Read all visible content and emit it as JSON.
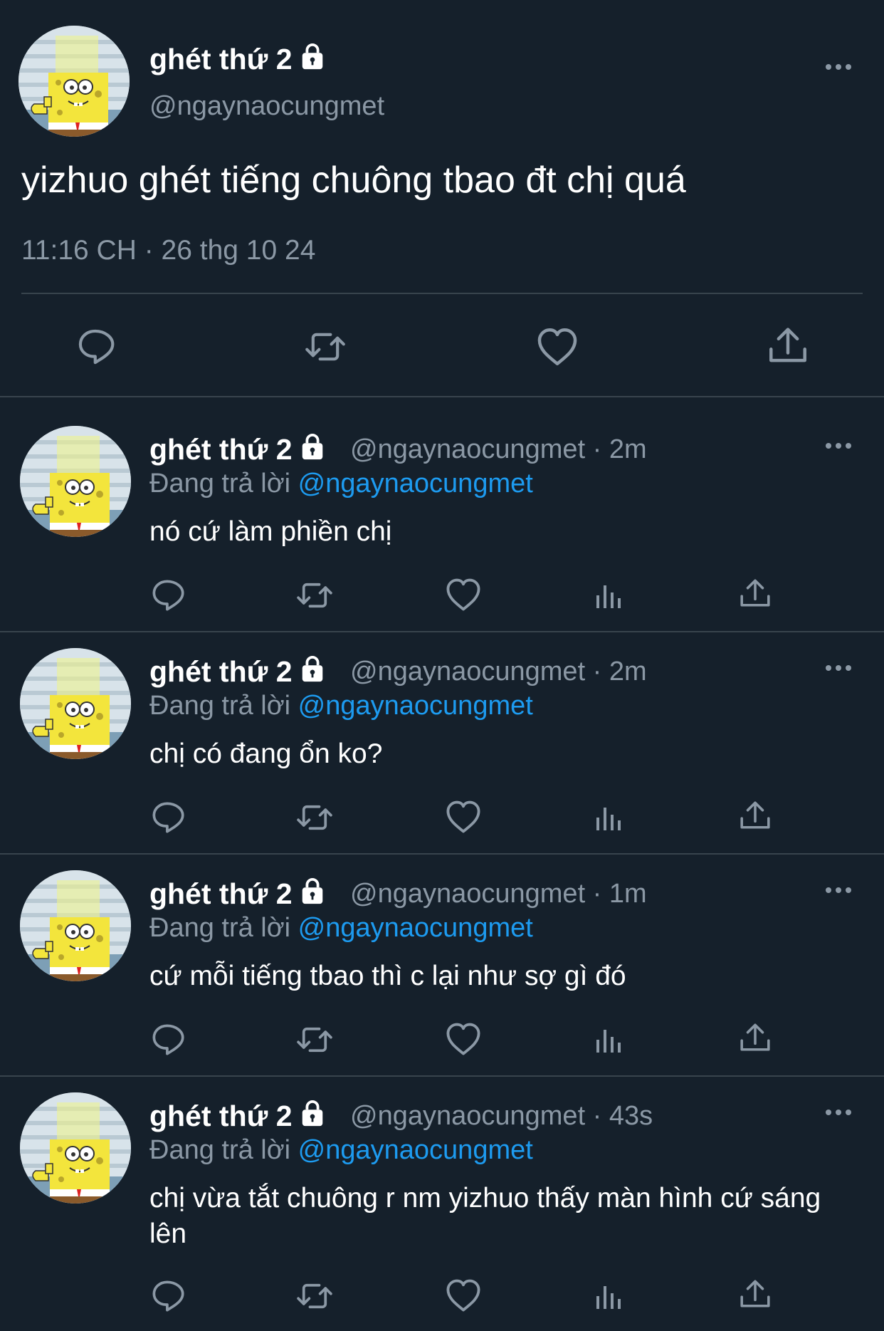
{
  "main_tweet": {
    "display_name": "ghét thứ 2",
    "handle": "@ngaynaocungmet",
    "text": "yizhuo ghét tiếng chuông tbao đt chị quá",
    "timestamp": "11:16 CH · 26 thg 10 24"
  },
  "reply_prefix": "Đang trả lời",
  "replies": [
    {
      "display_name": "ghét thứ 2",
      "meta": "@ngaynaocungmet · 2m",
      "reply_to": "@ngaynaocungmet",
      "text": "nó cứ làm phiền chị"
    },
    {
      "display_name": "ghét thứ 2",
      "meta": "@ngaynaocungmet · 2m",
      "reply_to": "@ngaynaocungmet",
      "text": "chị có đang ổn ko?"
    },
    {
      "display_name": "ghét thứ 2",
      "meta": "@ngaynaocungmet · 1m",
      "reply_to": "@ngaynaocungmet",
      "text": "cứ mỗi tiếng tbao thì c lại như sợ gì đó"
    },
    {
      "display_name": "ghét thứ 2",
      "meta": "@ngaynaocungmet · 43s",
      "reply_to": "@ngaynaocungmet",
      "text": "chị vừa tắt chuông r nm yizhuo thấy màn hình cứ sáng lên"
    }
  ],
  "icons": {
    "reply": "reply-icon",
    "retweet": "retweet-icon",
    "like": "heart-icon",
    "views": "analytics-icon",
    "share": "share-icon",
    "more": "more-icon",
    "lock": "lock-icon"
  },
  "colors": {
    "background": "#15202b",
    "text": "#ffffff",
    "secondary": "#8b98a5",
    "link": "#1d9bf0",
    "divider": "#38444d"
  }
}
